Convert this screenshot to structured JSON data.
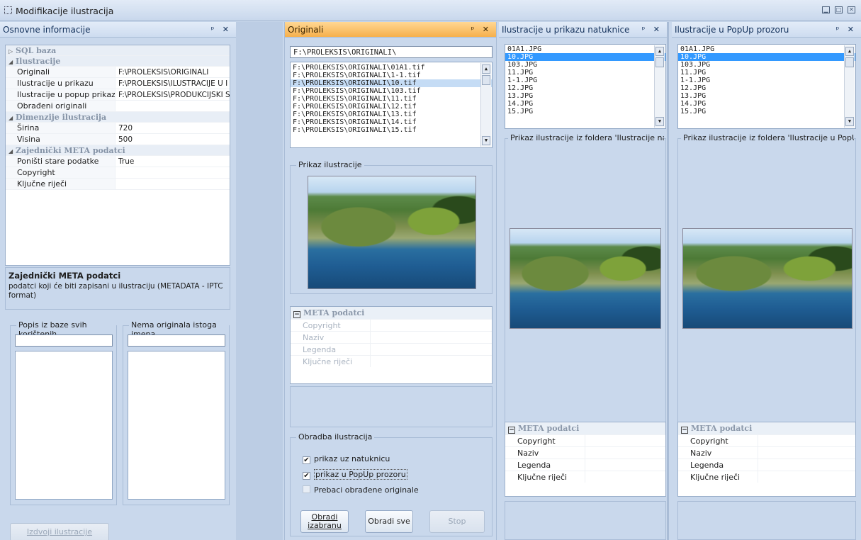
{
  "window": {
    "title": "Modifikacije ilustracija"
  },
  "left_panel": {
    "title": "Osnovne informacije",
    "pin": "ᵖ ✕",
    "grid": {
      "cat_sql": "SQL baza",
      "cat_ilustracije": "Ilustracije",
      "rows_ilustracije": [
        {
          "k": "Originali",
          "v": "F:\\PROLEKSIS\\ORIGINALI"
        },
        {
          "k": "Ilustracije u prikazu",
          "v": "F:\\PROLEKSIS\\ILUSTRACIJE U I"
        },
        {
          "k": "Ilustracije u popup prikazu",
          "v": "F:\\PROLEKSIS\\PRODUKCIJSKI S"
        },
        {
          "k": "Obrađeni originali",
          "v": ""
        }
      ],
      "cat_dimenzije": "Dimenzije ilustracija",
      "rows_dimenzije": [
        {
          "k": "Širina",
          "v": "720"
        },
        {
          "k": "Visina",
          "v": "500"
        }
      ],
      "cat_meta": "Zajednički META podatci",
      "rows_meta": [
        {
          "k": "Poništi stare podatke",
          "v": "True"
        },
        {
          "k": "Copyright",
          "v": ""
        },
        {
          "k": "Ključne riječi",
          "v": ""
        }
      ]
    },
    "description": {
      "title": "Zajednički META podatci",
      "text": "podatci koji će biti zapisani u ilustraciju (METADATA - IPTC format)"
    },
    "group_used": "Popis iz baze svih korištenih",
    "group_missing": "Nema originala istoga imena",
    "extract_button": "Izdvoji ilustracije"
  },
  "originals_panel": {
    "title": "Originali",
    "pin": "ᵖ ✕",
    "path": "F:\\PROLEKSIS\\ORIGINALI\\",
    "files": [
      "F:\\PROLEKSIS\\ORIGINALI\\01A1.tif",
      "F:\\PROLEKSIS\\ORIGINALI\\1-1.tif",
      "F:\\PROLEKSIS\\ORIGINALI\\10.tif",
      "F:\\PROLEKSIS\\ORIGINALI\\103.tif",
      "F:\\PROLEKSIS\\ORIGINALI\\11.tif",
      "F:\\PROLEKSIS\\ORIGINALI\\12.tif",
      "F:\\PROLEKSIS\\ORIGINALI\\13.tif",
      "F:\\PROLEKSIS\\ORIGINALI\\14.tif",
      "F:\\PROLEKSIS\\ORIGINALI\\15.tif"
    ],
    "selected_index": 2,
    "preview_label": "Prikaz ilustracije",
    "meta": {
      "title": "META podatci",
      "rows": [
        "Copyright",
        "Naziv",
        "Legenda",
        "Ključne riječi"
      ]
    },
    "processing": {
      "title": "Obradba ilustracija",
      "cb1": "prikaz uz natuknicu",
      "cb2": "prikaz u PopUp prozoru",
      "cb3": "Prebaci obrađene originale",
      "btn_process_selected": "Obradi izabranu",
      "btn_process_all": "Obradi sve",
      "btn_stop": "Stop"
    }
  },
  "web_panel": {
    "title": "Ilustracije u prikazu natuknice",
    "pin": "ᵖ ✕",
    "files": [
      "01A1.JPG",
      "10.JPG",
      "103.JPG",
      "11.JPG",
      "1-1.JPG",
      "12.JPG",
      "13.JPG",
      "14.JPG",
      "15.JPG"
    ],
    "selected_index": 1,
    "preview_label": "Prikaz ilustracije iz foldera 'Ilustracije na WEB",
    "meta": {
      "title": "META podatci",
      "rows": [
        "Copyright",
        "Naziv",
        "Legenda",
        "Ključne riječi"
      ]
    }
  },
  "popup_panel": {
    "title": "Ilustracije u PopUp prozoru",
    "pin": "ᵖ ✕",
    "files": [
      "01A1.JPG",
      "10.JPG",
      "103.JPG",
      "11.JPG",
      "1-1.JPG",
      "12.JPG",
      "13.JPG",
      "14.JPG",
      "15.JPG"
    ],
    "selected_index": 1,
    "preview_label": "Prikaz ilustracije iz foldera 'Ilustracije u PopUp proz",
    "meta": {
      "title": "META podatci",
      "rows": [
        "Copyright",
        "Naziv",
        "Legenda",
        "Ključne riječi"
      ]
    }
  }
}
